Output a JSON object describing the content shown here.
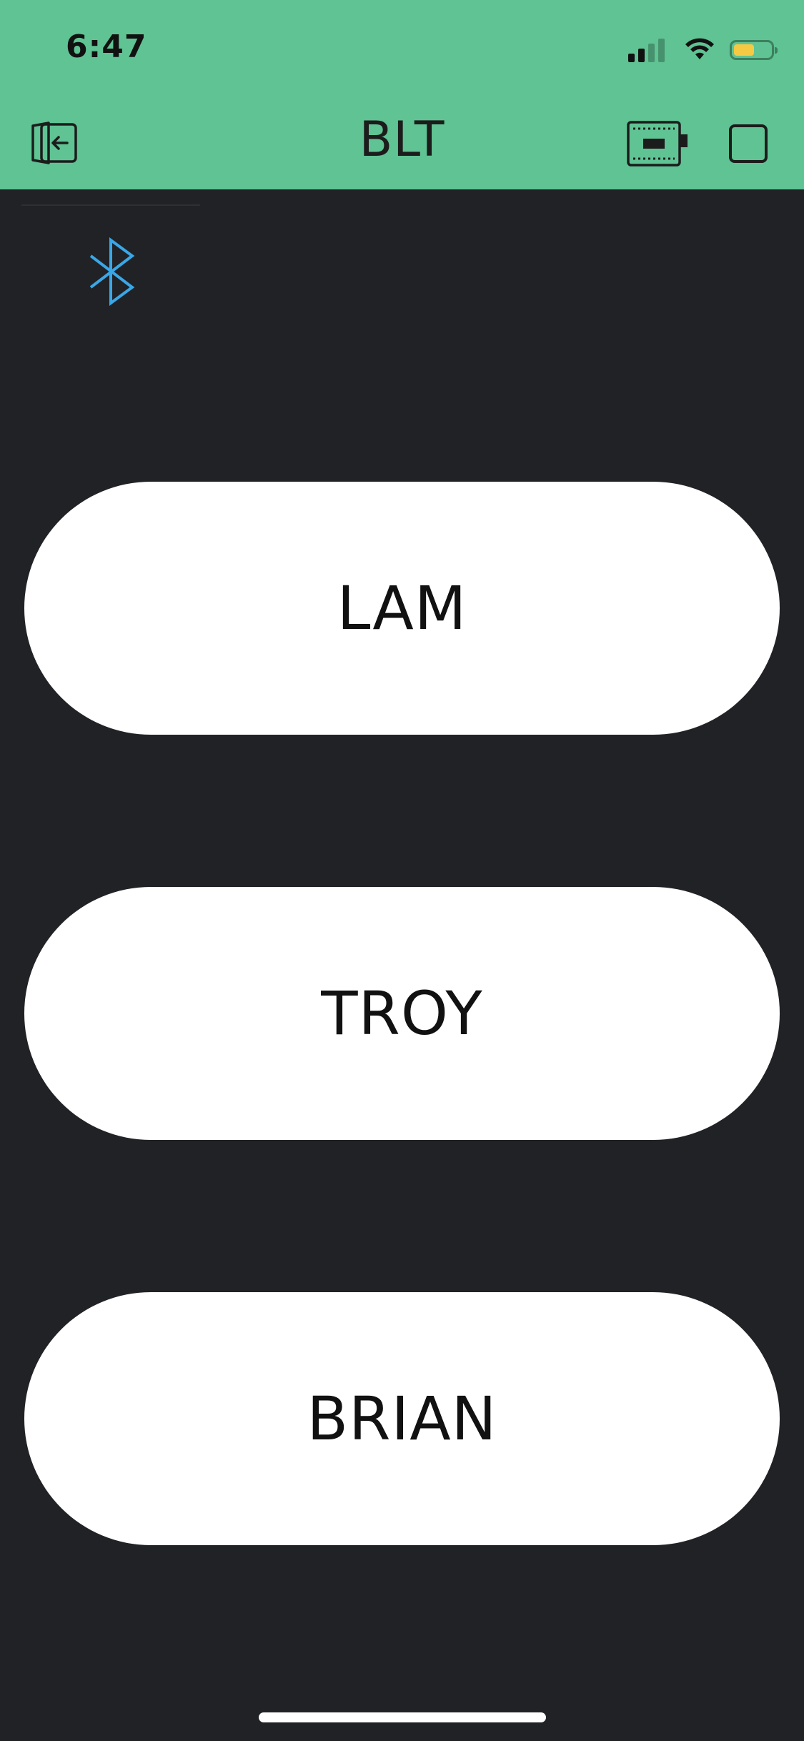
{
  "status_bar": {
    "time": "6:47",
    "signal_icon": "cellular-signal-icon",
    "wifi_icon": "wifi-icon",
    "battery_icon": "battery-icon",
    "battery_level": 0.55,
    "battery_color": "#f6c945"
  },
  "nav": {
    "title": "BLT",
    "exit_icon": "exit-icon",
    "device_icon": "device-board-icon",
    "square_icon": "stop-square-icon"
  },
  "bluetooth": {
    "icon": "bluetooth-icon",
    "color": "#3aa7e6"
  },
  "buttons": [
    {
      "label": "LAM"
    },
    {
      "label": "TROY"
    },
    {
      "label": "BRIAN"
    }
  ],
  "theme": {
    "header_bg": "#5fc393",
    "body_bg": "#212226",
    "button_bg": "#ffffff"
  }
}
